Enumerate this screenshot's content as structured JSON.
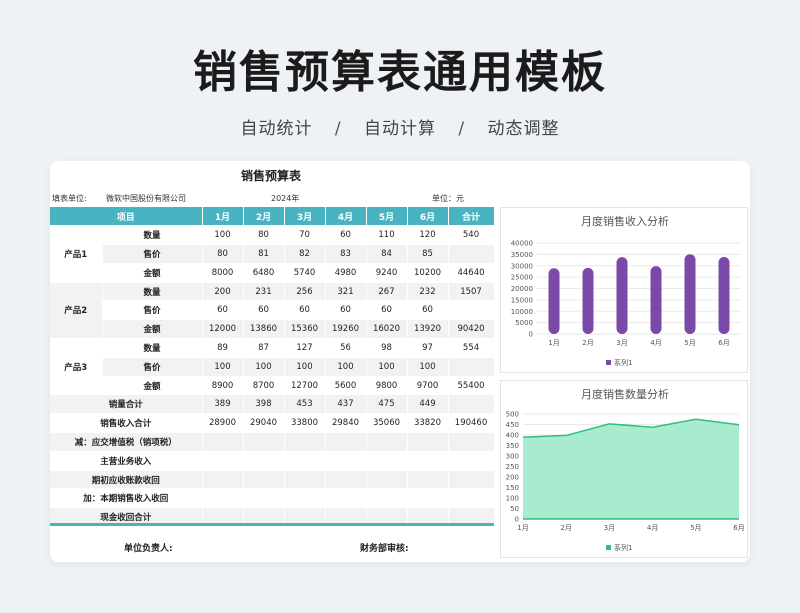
{
  "hero": {
    "title": "销售预算表通用模板",
    "tags": [
      "自动统计",
      "自动计算",
      "动态调整"
    ],
    "separator": "/"
  },
  "sheet": {
    "title": "销售预算表",
    "unit_label": "填表单位:",
    "unit_value": "微软中国股份有限公司",
    "year": "2024年",
    "currency": "单位：元",
    "columns": [
      "项目",
      "1月",
      "2月",
      "3月",
      "4月",
      "5月",
      "6月",
      "合计"
    ],
    "products": [
      {
        "name": "产品1",
        "rows": [
          {
            "label": "数量",
            "values": [
              "100",
              "80",
              "70",
              "60",
              "110",
              "120",
              "540"
            ]
          },
          {
            "label": "售价",
            "values": [
              "80",
              "81",
              "82",
              "83",
              "84",
              "85",
              ""
            ]
          },
          {
            "label": "金额",
            "values": [
              "8000",
              "6480",
              "5740",
              "4980",
              "9240",
              "10200",
              "44640"
            ]
          }
        ]
      },
      {
        "name": "产品2",
        "rows": [
          {
            "label": "数量",
            "values": [
              "200",
              "231",
              "256",
              "321",
              "267",
              "232",
              "1507"
            ]
          },
          {
            "label": "售价",
            "values": [
              "60",
              "60",
              "60",
              "60",
              "60",
              "60",
              ""
            ]
          },
          {
            "label": "金额",
            "values": [
              "12000",
              "13860",
              "15360",
              "19260",
              "16020",
              "13920",
              "90420"
            ]
          }
        ]
      },
      {
        "name": "产品3",
        "rows": [
          {
            "label": "数量",
            "values": [
              "89",
              "87",
              "127",
              "56",
              "98",
              "97",
              "554"
            ]
          },
          {
            "label": "售价",
            "values": [
              "100",
              "100",
              "100",
              "100",
              "100",
              "100",
              ""
            ]
          },
          {
            "label": "金额",
            "values": [
              "8900",
              "8700",
              "12700",
              "5600",
              "9800",
              "9700",
              "55400"
            ]
          }
        ]
      }
    ],
    "summary": [
      {
        "label": "销量合计",
        "values": [
          "389",
          "398",
          "453",
          "437",
          "475",
          "449",
          ""
        ]
      },
      {
        "label": "销售收入合计",
        "values": [
          "28900",
          "29040",
          "33800",
          "29840",
          "35060",
          "33820",
          "190460"
        ]
      },
      {
        "label": "减：应交增值税（销项税）",
        "values": [
          "",
          "",
          "",
          "",
          "",
          "",
          ""
        ]
      },
      {
        "label": "主营业务收入",
        "values": [
          "",
          "",
          "",
          "",
          "",
          "",
          ""
        ]
      },
      {
        "label": "期初应收账款收回",
        "values": [
          "",
          "",
          "",
          "",
          "",
          "",
          ""
        ]
      },
      {
        "label": "加：本期销售收入收回",
        "values": [
          "",
          "",
          "",
          "",
          "",
          "",
          ""
        ]
      },
      {
        "label": "现金收回合计",
        "values": [
          "",
          "",
          "",
          "",
          "",
          "",
          ""
        ]
      }
    ],
    "sign_left": "单位负责人:",
    "sign_right": "财务部审核:"
  },
  "chart_data": [
    {
      "type": "bar",
      "title": "月度销售收入分析",
      "categories": [
        "1月",
        "2月",
        "3月",
        "4月",
        "5月",
        "6月"
      ],
      "series": [
        {
          "name": "系列1",
          "values": [
            28900,
            29040,
            33800,
            29840,
            35060,
            33820
          ]
        }
      ],
      "ylim": [
        0,
        40000
      ],
      "yticks": [
        "0",
        "5000",
        "10000",
        "15000",
        "20000",
        "25000",
        "30000",
        "35000",
        "40000"
      ],
      "color": "#7b4aa8",
      "legend": "bottom"
    },
    {
      "type": "area",
      "title": "月度销售数量分析",
      "categories": [
        "1月",
        "2月",
        "3月",
        "4月",
        "5月",
        "6月"
      ],
      "series": [
        {
          "name": "系列1",
          "values": [
            389,
            398,
            453,
            437,
            475,
            449
          ]
        }
      ],
      "ylim": [
        0,
        500
      ],
      "yticks": [
        "0",
        "50",
        "100",
        "150",
        "200",
        "250",
        "300",
        "350",
        "400",
        "450",
        "500"
      ],
      "color": "#2fbf7e",
      "fill": "#a8ebcf",
      "legend": "bottom"
    }
  ]
}
